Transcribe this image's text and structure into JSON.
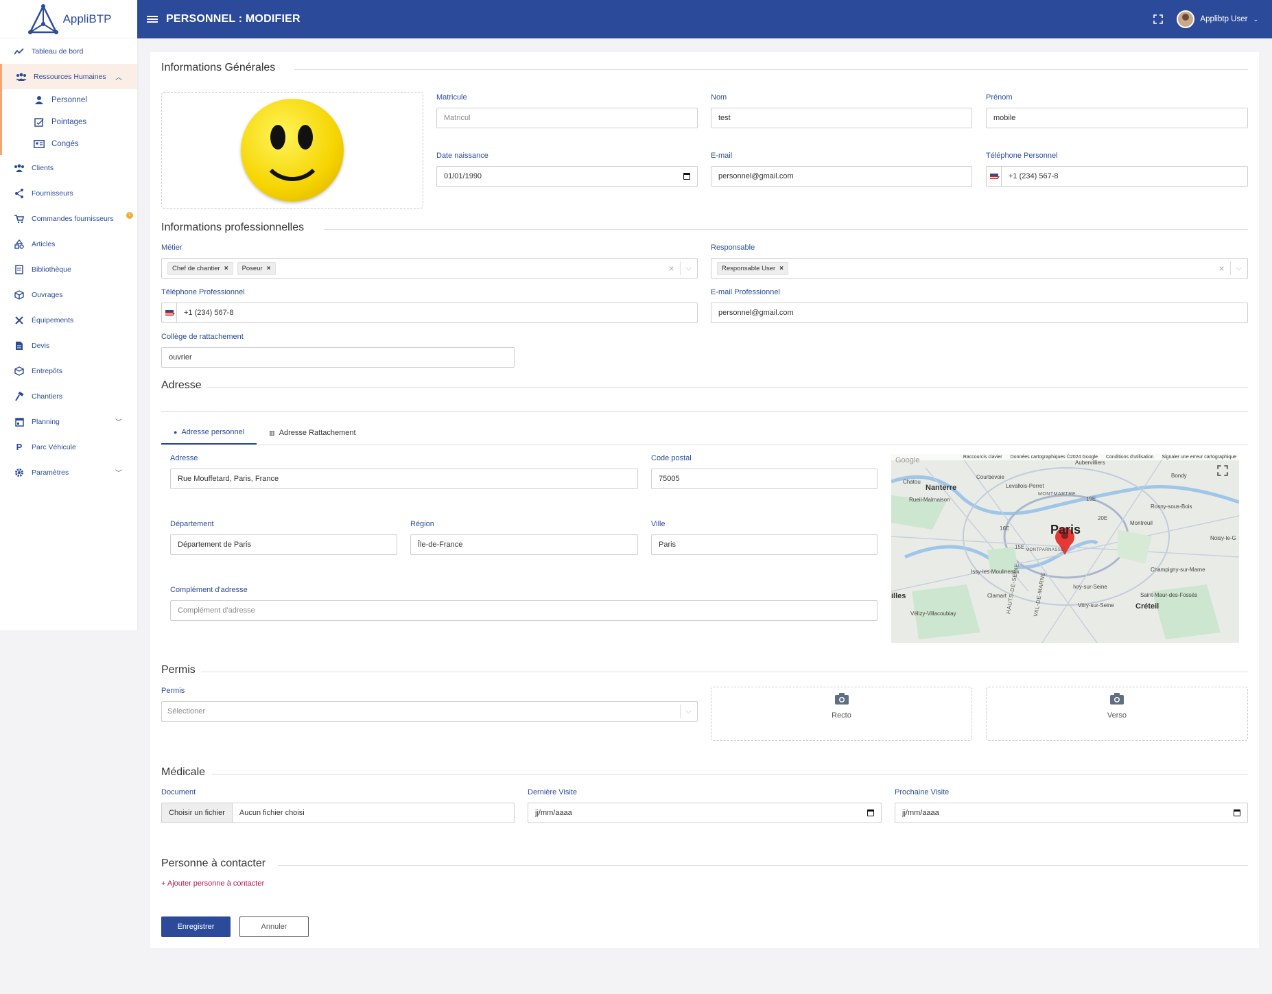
{
  "app": {
    "logo_text": "Appli",
    "logo_suffix": "BTP"
  },
  "topbar": {
    "title": "PERSONNEL : MODIFIER",
    "user": "Applibtp User"
  },
  "sidebar": {
    "items": [
      {
        "label": "Tableau de bord",
        "icon": "chart-line-icon"
      },
      {
        "label": "Ressources Humaines",
        "icon": "users-icon"
      },
      {
        "label": "Clients",
        "icon": "users-icon"
      },
      {
        "label": "Fournisseurs",
        "icon": "share-icon"
      },
      {
        "label": "Commandes fournisseurs",
        "icon": "cart-icon",
        "badge": "1"
      },
      {
        "label": "Articles",
        "icon": "articles-icon"
      },
      {
        "label": "Bibliothèque",
        "icon": "book-icon"
      },
      {
        "label": "Ouvrages",
        "icon": "box-icon"
      },
      {
        "label": "Équipements",
        "icon": "tools-icon"
      },
      {
        "label": "Devis",
        "icon": "document-icon"
      },
      {
        "label": "Entrepôts",
        "icon": "warehouse-icon"
      },
      {
        "label": "Chantiers",
        "icon": "hammer-icon"
      },
      {
        "label": "Planning",
        "icon": "calendar-icon"
      },
      {
        "label": "Parc Véhicule",
        "icon": "parking-icon"
      },
      {
        "label": "Paramètres",
        "icon": "gear-icon"
      }
    ],
    "sub_items": [
      {
        "label": "Personnel"
      },
      {
        "label": "Pointages"
      },
      {
        "label": "Congés"
      }
    ]
  },
  "general": {
    "title": "Informations Générales",
    "matricule_label": "Matricule",
    "matricule_placeholder": "Matricul",
    "nom_label": "Nom",
    "nom_value": "test",
    "prenom_label": "Prénom",
    "prenom_value": "mobile",
    "date_label": "Date naissance",
    "date_value": "01/01/1990",
    "email_label": "E-mail",
    "email_value": "personnel@gmail.com",
    "tel_label": "Téléphone Personnel",
    "tel_value": "+1 (234) 567-8"
  },
  "pro": {
    "title": "Informations professionnelles",
    "metier_label": "Métier",
    "metier_tags": [
      "Chef de chantier",
      "Poseur"
    ],
    "resp_label": "Responsable",
    "resp_tags": [
      "Responsable User"
    ],
    "tel_label": "Téléphone Professionnel",
    "tel_value": "+1 (234) 567-8",
    "email_label": "E-mail Professionnel",
    "email_value": "personnel@gmail.com",
    "college_label": "Collège de rattachement",
    "college_value": "ouvrier"
  },
  "address": {
    "title": "Adresse",
    "tab1": "Adresse personnel",
    "tab2": "Adresse Rattachement",
    "adresse_label": "Adresse",
    "adresse_value": "Rue Mouffetard, Paris, France",
    "cp_label": "Code postal",
    "cp_value": "75005",
    "dep_label": "Département",
    "dep_value": "Département de Paris",
    "region_label": "Région",
    "region_value": "Île-de-France",
    "ville_label": "Ville",
    "ville_value": "Paris",
    "comp_label": "Complément d'adresse",
    "comp_placeholder": "Complément d'adresse",
    "map": {
      "attribution": [
        "Raccourcis clavier",
        "Données cartographiques ©2024 Google",
        "Conditions d'utilisation",
        "Signaler une erreur cartographique"
      ],
      "places": [
        "Paris",
        "Nanterre",
        "Courbevoie",
        "Levallois-Perret",
        "Aubervilliers",
        "Bondy",
        "Chatou",
        "Rueil-Malmaison",
        "MONTMARTRE",
        "19E",
        "20E",
        "16E",
        "15E",
        "MONTPARNASSE",
        "Montreuil",
        "Rosny-sous-Bois",
        "Noisy-le-G",
        "Issy-les-Moulineaux",
        "Ivry-sur-Seine",
        "Champigny-sur-Marne",
        "Clamart",
        "Vitry-sur-Seine",
        "Saint-Maur-des-Fossés",
        "Créteil",
        "Vélizy-Villacoublay",
        "illes",
        "HAUTS-DE-SEINE",
        "VAL-DE-MARNE",
        "Google"
      ]
    }
  },
  "permis": {
    "title": "Permis",
    "label": "Permis",
    "placeholder": "Sélectioner",
    "recto": "Recto",
    "verso": "Verso"
  },
  "medical": {
    "title": "Médicale",
    "doc_label": "Document",
    "file_btn": "Choisir un fichier",
    "file_txt": "Aucun fichier choisi",
    "last_label": "Dernière Visite",
    "last_value": "jj/mm/aaaa",
    "next_label": "Prochaine Visite",
    "next_value": "jj/mm/aaaa"
  },
  "contact": {
    "title": "Personne à contacter",
    "add": "+ Ajouter personne à contacter"
  },
  "actions": {
    "save": "Enregistrer",
    "cancel": "Annuler"
  },
  "colors": {
    "primary": "#2b4a99",
    "accent": "#f3a673",
    "link": "#b0184c"
  }
}
